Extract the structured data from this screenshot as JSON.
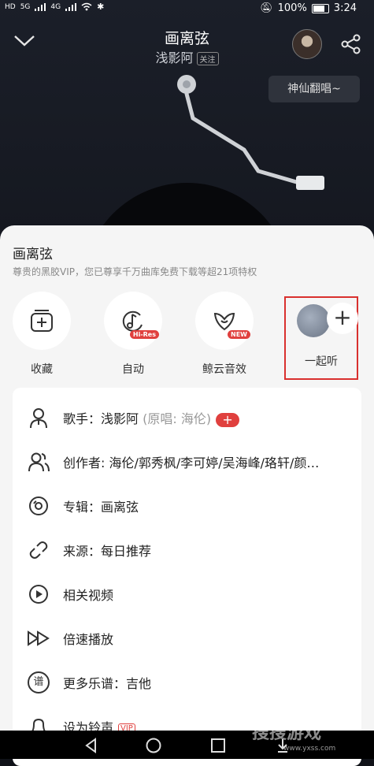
{
  "status_bar": {
    "left_labels": [
      "HD",
      "5G",
      "4G"
    ],
    "battery": "100%",
    "time": "3:24"
  },
  "player": {
    "song_title": "画离弦",
    "artist": "浅影阿",
    "follow_label": "关注",
    "bubble_text": "神仙翻唱~"
  },
  "sheet": {
    "title": "画离弦",
    "subtitle": "尊贵的黑胶VIP，您已尊享千万曲库免费下载等超21项特权",
    "actions": [
      {
        "label": "收藏",
        "icon": "collect-icon"
      },
      {
        "label": "自动",
        "icon": "hires-icon",
        "badge": "Hi-Res"
      },
      {
        "label": "鲸云音效",
        "icon": "whale-sound-icon",
        "badge": "NEW"
      },
      {
        "label": "一起听",
        "icon": "listen-together-icon"
      }
    ],
    "menu": [
      {
        "label": "歌手：浅影阿",
        "hint": "(原唱: 海伦)",
        "icon": "singer-icon",
        "extra": "+"
      },
      {
        "label": "创作者: 海伦/郭秀枫/李可婷/吴海峰/珞轩/颜…",
        "icon": "creators-icon"
      },
      {
        "label": "专辑：画离弦",
        "icon": "album-icon"
      },
      {
        "label": "来源：每日推荐",
        "icon": "source-icon"
      },
      {
        "label": "相关视频",
        "icon": "video-icon"
      },
      {
        "label": "倍速播放",
        "icon": "speed-icon"
      },
      {
        "label": "更多乐谱：吉他",
        "icon": "score-icon",
        "icon_glyph": "谱"
      },
      {
        "label": "设为铃声",
        "icon": "ringtone-icon",
        "tag": "VIP"
      }
    ]
  },
  "watermark": {
    "main": "搜搜游戏",
    "url": "www.yxss.com"
  }
}
